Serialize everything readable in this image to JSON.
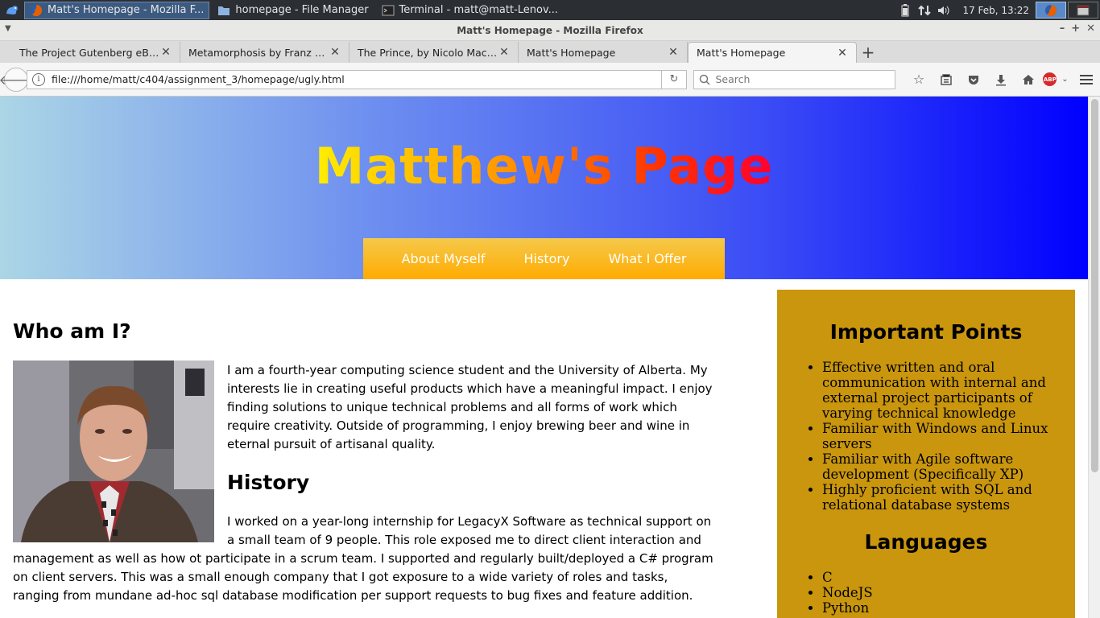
{
  "taskbar": {
    "tasks": [
      {
        "label": "Matt's Homepage - Mozilla F...",
        "icon": "firefox-icon",
        "active": true
      },
      {
        "label": "homepage - File Manager",
        "icon": "folder-icon",
        "active": false
      },
      {
        "label": "Terminal - matt@matt-Lenov...",
        "icon": "terminal-icon",
        "active": false
      }
    ],
    "clock": "17 Feb, 13:22"
  },
  "browser": {
    "window_title": "Matt's Homepage - Mozilla Firefox",
    "tabs": [
      {
        "title": "The Project Gutenberg eBook..."
      },
      {
        "title": "Metamorphosis by Franz Kafka"
      },
      {
        "title": "The Prince, by Nicolo Machia..."
      },
      {
        "title": "Matt's Homepage"
      },
      {
        "title": "Matt's Homepage",
        "selected": true
      }
    ],
    "url": "file:///home/matt/c404/assignment_3/homepage/ugly.html",
    "search_placeholder": "Search",
    "abp_label": "ABP"
  },
  "page": {
    "site_title": "Matthew's Page",
    "nav": [
      "About Myself",
      "History",
      "What I Offer"
    ],
    "who_title": "Who am I?",
    "who_text": "I am a fourth-year computing science student and the University of Alberta. My interests lie in creating useful products which have a meaningful impact. I enjoy finding solutions to unique technical problems and all forms of work which require creativity. Outside of programming, I enjoy brewing beer and wine in eternal pursuit of artisanal quality.",
    "history_title": "History",
    "history_text_1": "I worked on a year-long internship for LegacyX Software as technical support on a small team of 9 people. This role exposed me to direct client interaction and",
    "history_text_2": "management as well as how ot participate in a scrum team. I supported and regularly built/deployed a C# program on client servers. This was a small enough company that I got exposure to a wide variety of roles and tasks, ranging from mundane ad-hoc sql database modification per support requests to bug fixes and feature addition.",
    "sidebar": {
      "points_title": "Important Points",
      "points": [
        "Effective written and oral communication with internal and external project participants of varying technical knowledge",
        "Familiar with Windows and Linux servers",
        "Familiar with Agile software development (Specifically XP)",
        "Highly proficient with SQL and relational database systems"
      ],
      "languages_title": "Languages",
      "languages": [
        "C",
        "NodeJS",
        "Python"
      ]
    }
  },
  "colors": {
    "sidebar_bg": "#c9960e",
    "nav_bg": "#ffab00",
    "header_gradient_end": "#0000ff"
  }
}
